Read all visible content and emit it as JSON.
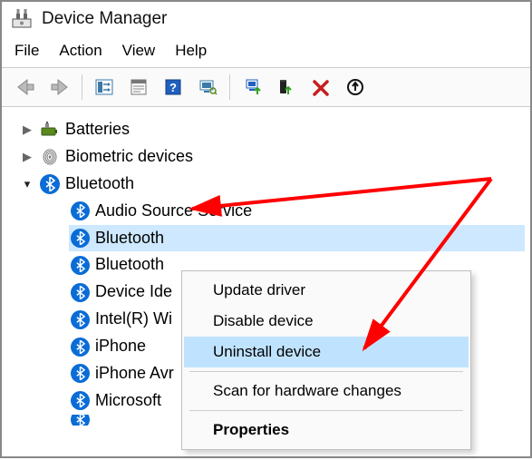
{
  "window": {
    "title": "Device Manager"
  },
  "menu": {
    "file": "File",
    "action": "Action",
    "view": "View",
    "help": "Help"
  },
  "tree": {
    "batteries": {
      "label": "Batteries"
    },
    "biometric": {
      "label": "Biometric devices"
    },
    "bluetooth": {
      "label": "Bluetooth",
      "children": {
        "audio": "Audio Source Service",
        "btdev": "Bluetooth",
        "btdev2": "Bluetooth",
        "devid": "Device Ide",
        "intel": "Intel(R) Wi",
        "iphone": "iPhone",
        "iphoneavr": "iPhone Avr",
        "ms": "Microsoft "
      }
    }
  },
  "context": {
    "update": "Update driver",
    "disable": "Disable device",
    "uninstall": "Uninstall device",
    "scan": "Scan for hardware changes",
    "properties": "Properties"
  }
}
